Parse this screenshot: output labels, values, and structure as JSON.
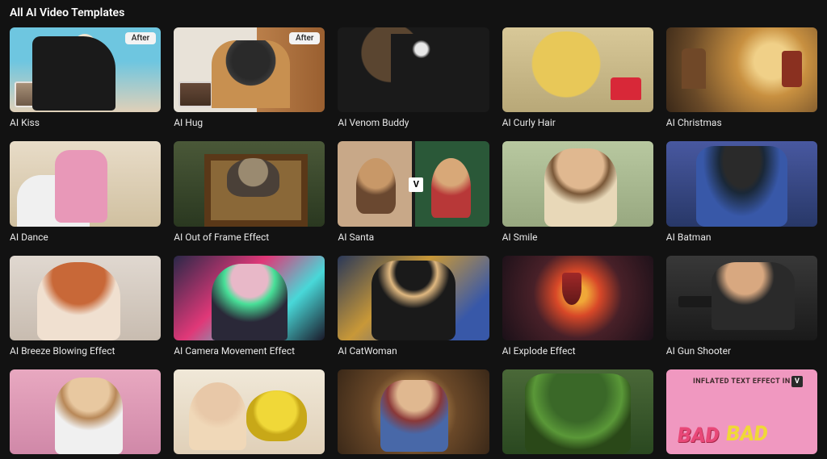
{
  "section_title": "All AI Video Templates",
  "badges": {
    "after": "After"
  },
  "templates": [
    {
      "label": "AI Kiss",
      "badge": "after",
      "inset": true
    },
    {
      "label": "AI Hug",
      "badge": "after",
      "inset": true
    },
    {
      "label": "AI Venom Buddy"
    },
    {
      "label": "AI Curly Hair"
    },
    {
      "label": "AI Christmas"
    },
    {
      "label": "AI Dance"
    },
    {
      "label": "AI Out of Frame Effect"
    },
    {
      "label": "AI Santa",
      "vbadge": "V"
    },
    {
      "label": "AI Smile"
    },
    {
      "label": "AI Batman"
    },
    {
      "label": "AI Breeze Blowing Effect"
    },
    {
      "label": "AI Camera Movement Effect"
    },
    {
      "label": "AI CatWoman"
    },
    {
      "label": "AI Explode Effect"
    },
    {
      "label": "AI Gun Shooter"
    },
    {
      "label": ""
    },
    {
      "label": ""
    },
    {
      "label": ""
    },
    {
      "label": ""
    },
    {
      "label": "",
      "vbadge": "V"
    }
  ]
}
